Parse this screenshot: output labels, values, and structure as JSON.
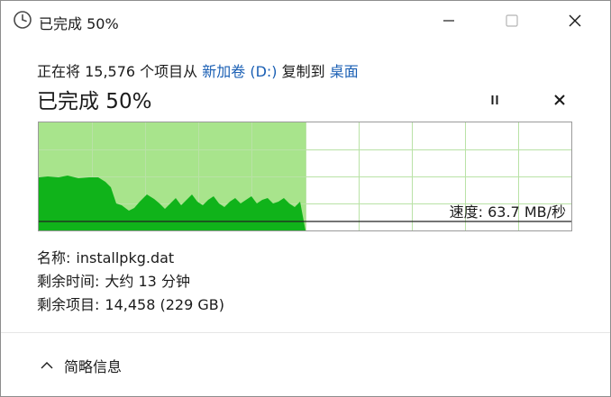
{
  "window": {
    "title": "已完成 50%",
    "icons": {
      "app": "clock-icon",
      "minimize": "minimize-icon",
      "maximize": "maximize-icon",
      "close": "close-icon"
    }
  },
  "operation": {
    "prefix": "正在将 15,576 个项目从 ",
    "source": "新加卷 (D:)",
    "middle": " 复制到 ",
    "destination": "桌面"
  },
  "progress": {
    "status": "已完成 50%",
    "percent": 50,
    "pause_icon": "pause-icon",
    "cancel_icon": "cancel-icon"
  },
  "speed": {
    "label": "速度: 63.7 MB/秒",
    "value_mb_per_s": 63.7
  },
  "info": {
    "name_label": "名称:",
    "name_value": "installpkg.dat",
    "time_label": "剩余时间:",
    "time_value": "大约 13 分钟",
    "items_label": "剩余项目:",
    "items_value": "14,458 (229 GB)"
  },
  "footer": {
    "details_label": "简略信息",
    "chevron_icon": "chevron-up-icon"
  },
  "colors": {
    "progress_fill": "#a8e48c",
    "speed_fill": "#10b31a",
    "grid": "#b9e2a6",
    "link": "#1a5fb4"
  }
}
